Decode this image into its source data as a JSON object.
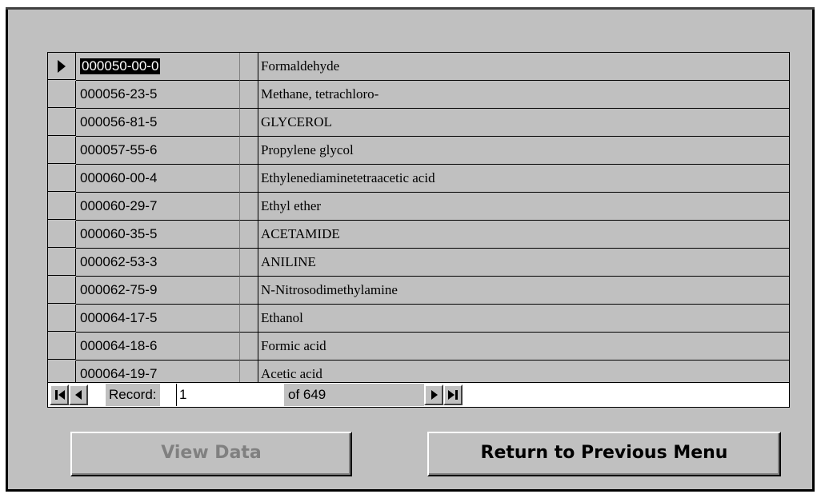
{
  "records": [
    {
      "cas": "000050-00-0",
      "name": "Formaldehyde"
    },
    {
      "cas": "000056-23-5",
      "name": "Methane, tetrachloro-"
    },
    {
      "cas": "000056-81-5",
      "name": "GLYCEROL"
    },
    {
      "cas": "000057-55-6",
      "name": "Propylene glycol"
    },
    {
      "cas": "000060-00-4",
      "name": "Ethylenediaminetetraacetic acid"
    },
    {
      "cas": "000060-29-7",
      "name": "Ethyl ether"
    },
    {
      "cas": "000060-35-5",
      "name": "ACETAMIDE"
    },
    {
      "cas": "000062-53-3",
      "name": "ANILINE"
    },
    {
      "cas": "000062-75-9",
      "name": "N-Nitrosodimethylamine"
    },
    {
      "cas": "000064-17-5",
      "name": "Ethanol"
    },
    {
      "cas": "000064-18-6",
      "name": "Formic acid"
    },
    {
      "cas": "000064-19-7",
      "name": "Acetic acid"
    }
  ],
  "navigation": {
    "record_label": "Record:",
    "current_record": "1",
    "of_text": "of  649"
  },
  "buttons": {
    "view_data": "View Data",
    "return_menu": "Return to Previous Menu"
  },
  "colors": {
    "background": "#c0c0c0",
    "disabled_text": "#808080"
  }
}
